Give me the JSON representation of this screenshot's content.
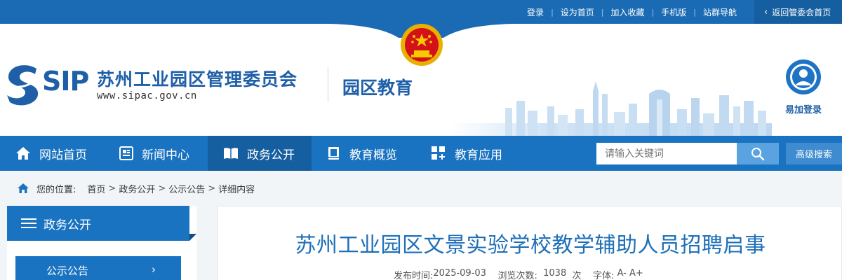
{
  "topbar": {
    "links": [
      "登录",
      "设为首页",
      "加入收藏",
      "手机版",
      "站群导航"
    ],
    "back_home": "返回管委会首页"
  },
  "header": {
    "logo_text": "SIP",
    "org_name": "苏州工业园区管理委员会",
    "org_url": "www.sipac.gov.cn",
    "sub_name": "园区教育",
    "login_label": "易加登录"
  },
  "nav": {
    "items": [
      {
        "label": "网站首页",
        "icon": "home-icon"
      },
      {
        "label": "新闻中心",
        "icon": "news-icon"
      },
      {
        "label": "政务公开",
        "icon": "book-icon",
        "active": true
      },
      {
        "label": "教育概览",
        "icon": "notebook-icon"
      },
      {
        "label": "教育应用",
        "icon": "apps-icon"
      }
    ],
    "search_placeholder": "请输入关键词",
    "advanced_search": "高级搜索"
  },
  "breadcrumb": {
    "label": "您的位置:",
    "items": [
      "首页",
      "政务公开",
      "公示公告",
      "详细内容"
    ]
  },
  "sidebar": {
    "title": "政务公开",
    "items": [
      "公示公告"
    ]
  },
  "article": {
    "title": "苏州工业园区文景实验学校教学辅助人员招聘启事",
    "publish_label": "发布时间:",
    "publish_date": "2025-09-03",
    "views_label": "浏览次数:",
    "views": "1038",
    "views_unit": "次",
    "font_label": "字体:",
    "font_smaller": "A-",
    "font_larger": "A+"
  },
  "colors": {
    "primary": "#1a73c0",
    "primary_dark": "#155e9f",
    "title_blue": "#1e6fb8"
  }
}
